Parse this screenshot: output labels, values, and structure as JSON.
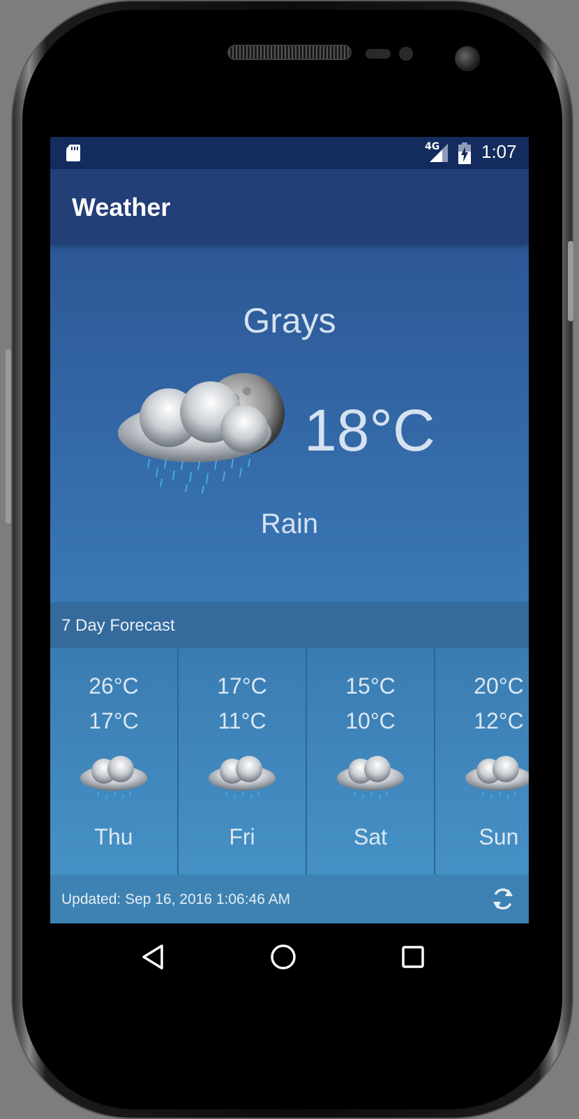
{
  "status_bar": {
    "network_label": "4G",
    "time": "1:07",
    "icons": [
      "sd-card-icon",
      "signal-icon",
      "battery-charging-icon"
    ]
  },
  "app_bar": {
    "title": "Weather"
  },
  "current": {
    "city": "Grays",
    "temperature": "18°C",
    "condition": "Rain",
    "icon": "rain-cloud-moon-icon"
  },
  "forecast": {
    "title": "7 Day Forecast",
    "days": [
      {
        "high": "26°C",
        "low": "17°C",
        "day": "Thu",
        "icon": "rain-cloud-icon"
      },
      {
        "high": "17°C",
        "low": "11°C",
        "day": "Fri",
        "icon": "rain-cloud-icon"
      },
      {
        "high": "15°C",
        "low": "10°C",
        "day": "Sat",
        "icon": "rain-cloud-icon"
      },
      {
        "high": "20°C",
        "low": "12°C",
        "day": "Sun",
        "icon": "rain-cloud-icon"
      }
    ]
  },
  "footer": {
    "updated": "Updated: Sep 16, 2016 1:06:46 AM",
    "refresh_icon": "refresh-icon"
  },
  "nav_bar": {
    "icons": [
      "back-icon",
      "home-icon",
      "recents-icon"
    ]
  },
  "colors": {
    "status_bar": "#142b5e",
    "app_bar": "#233f78",
    "hero_top": "#2c5796",
    "hero_bottom": "#3a78b6",
    "forecast_header": "#346a9c",
    "footer": "#3d82b2"
  }
}
